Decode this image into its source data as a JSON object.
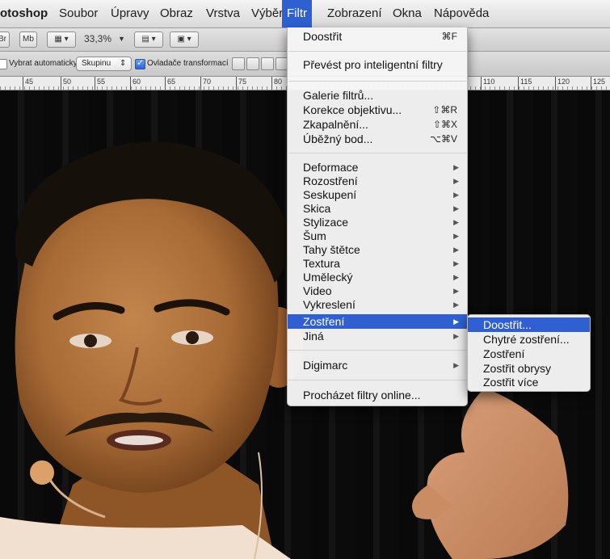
{
  "menubar": {
    "app": "otoshop",
    "items": [
      "Soubor",
      "Úpravy",
      "Obraz",
      "Vrstva",
      "Výběr",
      "Filtr",
      "Zobrazení",
      "Okna",
      "Nápověda"
    ]
  },
  "appbar": {
    "br_label": "Br",
    "mb_label": "Mb",
    "zoom": "33,3%"
  },
  "options": {
    "auto_select_label": "Vybrat automaticky:",
    "auto_select_value": "Skupinu",
    "transform_label": "Ovladače transformací",
    "auto_select_checked": false,
    "transform_checked": true
  },
  "ruler": {
    "left_ticks": [
      "45",
      "50",
      "55",
      "60",
      "65",
      "70",
      "75",
      "80"
    ],
    "right_ticks": [
      "110",
      "115",
      "120",
      "125"
    ]
  },
  "filter_menu": {
    "group1": [
      {
        "label": "Doostřit",
        "shortcut": "⌘F"
      }
    ],
    "group2": [
      {
        "label": "Převést pro inteligentní filtry",
        "shortcut": ""
      }
    ],
    "group3": [
      {
        "label": "Galerie filtrů...",
        "shortcut": ""
      },
      {
        "label": "Korekce objektivu...",
        "shortcut": "⇧⌘R"
      },
      {
        "label": "Zkapalnění...",
        "shortcut": "⇧⌘X"
      },
      {
        "label": "Úběžný bod...",
        "shortcut": "⌥⌘V"
      }
    ],
    "group4": [
      {
        "label": "Deformace"
      },
      {
        "label": "Rozostření"
      },
      {
        "label": "Seskupení"
      },
      {
        "label": "Skica"
      },
      {
        "label": "Stylizace"
      },
      {
        "label": "Šum"
      },
      {
        "label": "Tahy štětce"
      },
      {
        "label": "Textura"
      },
      {
        "label": "Umělecký"
      },
      {
        "label": "Video"
      },
      {
        "label": "Vykreslení"
      },
      {
        "label": "Zostření"
      },
      {
        "label": "Jiná"
      }
    ],
    "group5": [
      {
        "label": "Digimarc"
      }
    ],
    "group6": [
      {
        "label": "Procházet filtry online..."
      }
    ],
    "highlighted": "Zostření"
  },
  "submenu": {
    "items": [
      "Doostřit...",
      "Chytré zostření...",
      "Zostření",
      "Zostřit obrysy",
      "Zostřit více"
    ],
    "highlighted": "Doostřit..."
  },
  "colors": {
    "accent": "#2f5fd1",
    "menu_bg": "#f5f5f5"
  }
}
